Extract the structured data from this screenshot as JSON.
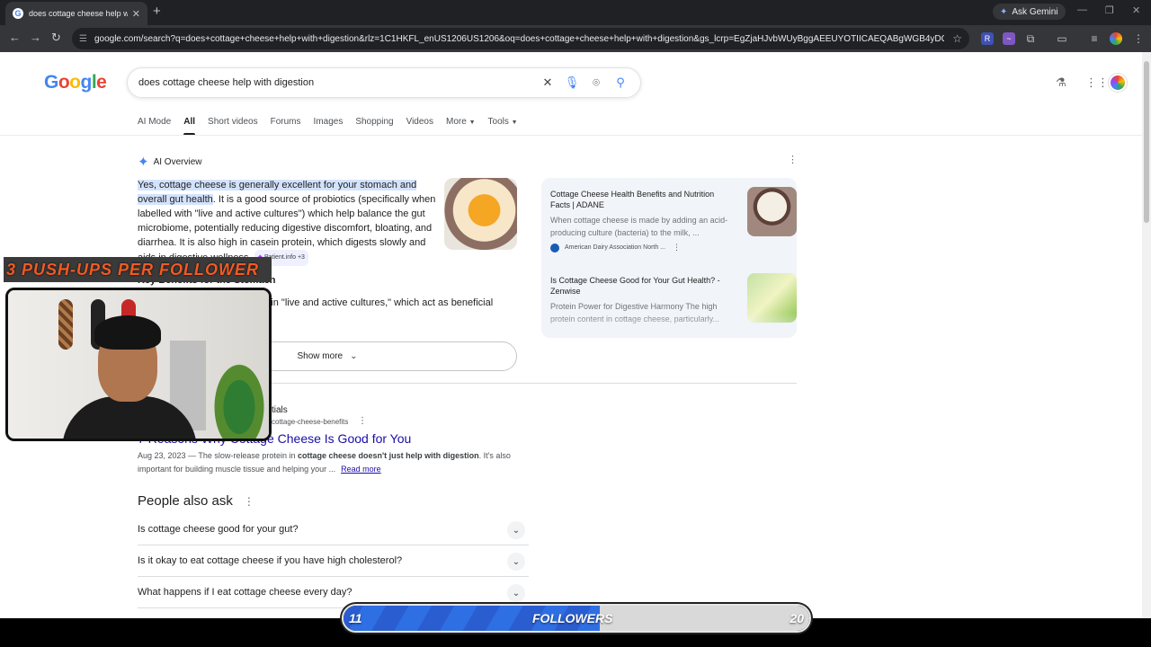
{
  "browser": {
    "tab_title": "does cottage cheese help with",
    "url": "google.com/search?q=does+cottage+cheese+help+with+digestion&rlz=1C1HKFL_enUS1206US1206&oq=does+cottage+cheese+help+with+digestion&gs_lcrp=EgZjaHJvbWUyBggAEEUYOTIICAEQABgWGB4yDQgCEAAYhgMYg...",
    "gemini_label": "Ask Gemini"
  },
  "search": {
    "query": "does cottage cheese help with digestion",
    "tabs": [
      "AI Mode",
      "All",
      "Short videos",
      "Forums",
      "Images",
      "Shopping",
      "Videos",
      "More",
      "Tools"
    ]
  },
  "ai_overview": {
    "label": "AI Overview",
    "highlight": "Yes, cottage cheese is generally excellent for your stomach and overall gut health",
    "body": ". It is a good source of probiotics (specifically when labelled with \"live and active cultures\") which help balance the gut microbiome, potentially reducing digestive discomfort, bloating, and diarrhea. It is also high in casein protein, which digests slowly and aids in digestive wellness.",
    "chip": "Patient.info +3",
    "key_benefits_title": "Key Benefits for the Stomach",
    "key_benefits_text": "ntain \"live and active cultures,\" which act as beneficial",
    "show_more": "Show more",
    "sources": [
      {
        "title": "Cottage Cheese Health Benefits and Nutrition Facts | ADANE",
        "snippet": "When cottage cheese is made by adding an acid-producing culture (bacteria) to the milk, ...",
        "publisher": "American Dairy Association North ..."
      },
      {
        "title": "Is Cottage Cheese Good for Your Gut Health? - Zenwise",
        "snippet": "Protein Power for Digestive Harmony The high protein content in cottage cheese, particularly..."
      }
    ]
  },
  "result": {
    "site": "tials",
    "url": "cottage-cheese-benefits",
    "title": "7 Reasons Why Cottage Cheese Is Good for You",
    "date": "Aug 23, 2023 —",
    "snippet_a": " The slow-release protein in ",
    "snippet_bold": "cottage cheese doesn't just help with digestion",
    "snippet_b": ". It's also important for building muscle tissue and helping your ...",
    "read_more": "Read more"
  },
  "people_also_ask": {
    "title": "People also ask",
    "questions": [
      "Is cottage cheese good for your gut?",
      "Is it okay to eat cottage cheese if you have high cholesterol?",
      "What happens if I eat cottage cheese every day?"
    ]
  },
  "overlay": {
    "banner": "3 PUSH-UPS PER FOLLOWER",
    "followers_label": "FOLLOWERS",
    "followers_current": "11",
    "followers_goal": "20",
    "progress_fraction": 0.55
  }
}
